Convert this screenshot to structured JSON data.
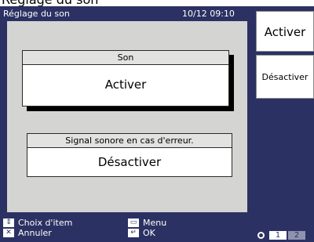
{
  "caption": "Réglage du son",
  "header": {
    "title": "Réglage du son",
    "datetime": "10/12 09:10"
  },
  "son": {
    "label": "Son",
    "value": "Activer"
  },
  "signal": {
    "label": "Signal sonore en cas d'erreur.",
    "value": "Désactiver"
  },
  "side_options": [
    "Activer",
    "Désactiver"
  ],
  "footer": {
    "choix": {
      "icon": "up-down-arrows-icon",
      "label": "Choix d'item"
    },
    "annuler": {
      "icon": "cancel-x-icon",
      "label": "Annuler"
    },
    "menu": {
      "icon": "menu-rect-icon",
      "label": "Menu"
    },
    "ok": {
      "icon": "enter-arrow-icon",
      "label": "OK"
    }
  },
  "pages": [
    "1",
    "2"
  ],
  "current_page": "1",
  "colors": {
    "background": "#2c3163",
    "panel": "#d4d4d2",
    "box": "#ffffff"
  }
}
